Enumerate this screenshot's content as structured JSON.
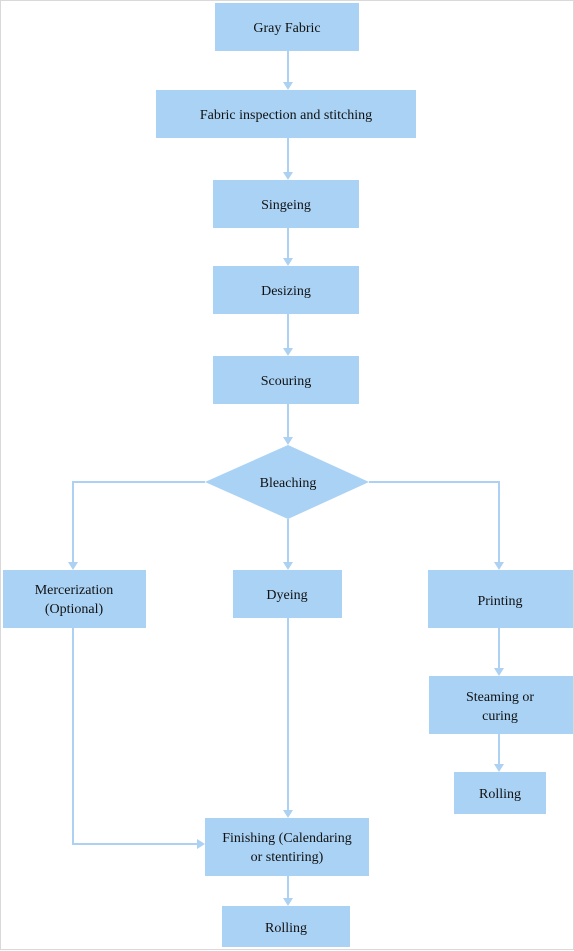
{
  "colors": {
    "node_fill": "#a9d2f5",
    "connector": "#acd1f2",
    "text": "#111111"
  },
  "nodes": {
    "gray_fabric": "Gray Fabric",
    "inspection": "Fabric inspection and stitching",
    "singeing": "Singeing",
    "desizing": "Desizing",
    "scouring": "Scouring",
    "bleaching": "Bleaching",
    "mercerization": [
      "Mercerization",
      "(Optional)"
    ],
    "dyeing": "Dyeing",
    "printing": "Printing",
    "steaming": [
      "Steaming or",
      "curing"
    ],
    "rolling_right": "Rolling",
    "finishing": [
      "Finishing (Calendaring",
      "or stentiring)"
    ],
    "rolling_bottom": "Rolling"
  }
}
